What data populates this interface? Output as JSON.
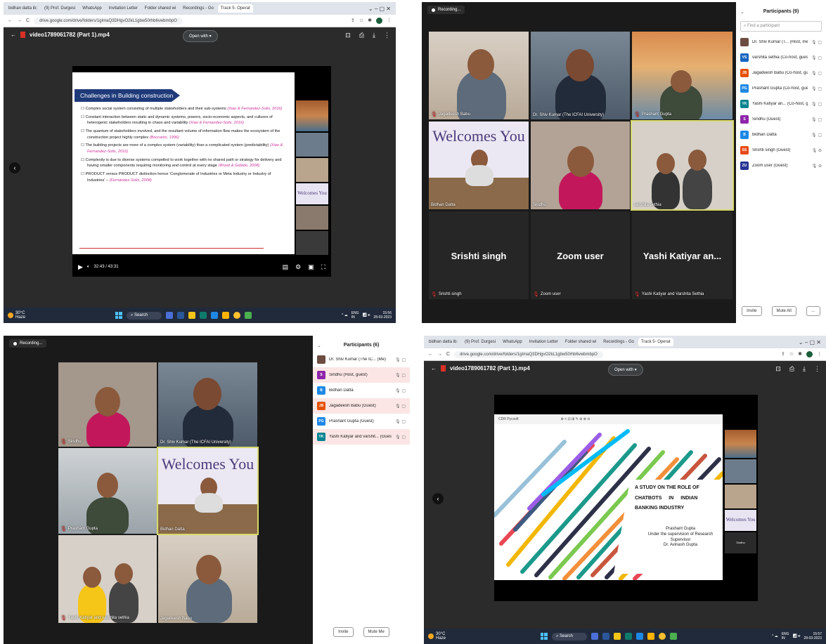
{
  "browser": {
    "tabs": [
      "bidhan datta ib:",
      "(9) Prof. Durgesi",
      "WhatsApp",
      "Invitation Letter",
      "Folder shared wi",
      "Recordings - Go",
      "Track 5- Operat"
    ],
    "url": "drive.google.com/drive/folders/1gImaQ3DHgvO2kL1gbw50rhb6vwbmbpO"
  },
  "player": {
    "file_name": "video1789061782 (Part 1).mp4",
    "open_with": "Open with",
    "time": "32:43 / 43:31"
  },
  "slide1": {
    "title": "Challenges in Building construction",
    "bullets": [
      {
        "text": "Complex social system consisting of multiple stakeholders and their sub-systems ",
        "cite": "(Xiao & Fernandez-Solis, 2016)"
      },
      {
        "text": "Constant interaction between static and dynamic systems, powers, socio-economic aspects, and cultures of heterogenic stakeholders resulting in chaos and variability ",
        "cite": "(Xiao & Fernandez-Solis, 2016)"
      },
      {
        "text": "The quantum of stakeholders involved, and the resultant volume of information flow makes the ecosystem of the construction project highly complex ",
        "cite": "(Boccarini, 1996)"
      },
      {
        "text": "The building projects are more of a complex system (variability) than a complicated system (predictability) ",
        "cite": "(Xiao & Fernandez-Solis, 2016)"
      },
      {
        "text": "Complexity is due to diverse systems compelled to work together with no shared path or strategy for delivery and having smaller components requiring monitoring and control at every stage ",
        "cite": "(Wood & Gidado, 2008)"
      },
      {
        "text": "PRODUCT versus PRODUCT distinction hence 'Conglomerate of Industries or Meta Industry or Industry of Industries' – ",
        "cite": "(Fernández-Solís, 2008)"
      }
    ]
  },
  "slide2": {
    "title_lines": [
      "A STUDY ON THE ROLE OF",
      "CHATBOTS IN INDIAN",
      "BANKING INDUSTRY"
    ],
    "author": "Prashant Gupta",
    "supervision": "Under the supervision of Research Supervisor",
    "supervisor": "Dr. Avinash Gupta",
    "toolbar_label": "CDR Pycsoft",
    "side_label": "Sindhu"
  },
  "welcome_text": "Welcomes You",
  "taskbar": {
    "temp": "30°C",
    "condition": "Haze",
    "search": "Search",
    "lang": "ENG",
    "region": "IN",
    "time1": "15:56",
    "date1": "28-03-2023",
    "time2": "15:57",
    "date2": "28-03-2023"
  },
  "meeting1": {
    "recording": "Recording...",
    "tiles": [
      "Jagadeesh Babu",
      "Dr. Shiv Kumar (The ICFAI University)",
      "Prashant Gupta",
      "Bidhan Datta",
      "Sindhu",
      "varshita sethia",
      "Srishti singh",
      "Zoom user",
      "Yashi Katiyar an..."
    ],
    "bottom_labels": [
      "Srishti singh",
      "Zoom user",
      "Yashi Katiyar and Varshita Sethia"
    ],
    "participants_title": "Participants (9)",
    "find": "Find a participant",
    "participants": [
      {
        "initials": "",
        "name": "Dr. Shiv Kumar (T... (Host, me)",
        "color": "#6d4c41"
      },
      {
        "initials": "VS",
        "name": "varshita sethia (Co-host, guest)",
        "color": "#1565c0"
      },
      {
        "initials": "JB",
        "name": "Jagadeesh Babu (Co-host, guest)",
        "color": "#e65100"
      },
      {
        "initials": "PG",
        "name": "Prashant Gupta (Co-host, guest)",
        "color": "#1e88e5"
      },
      {
        "initials": "YK",
        "name": "Yashi Katiyar an... (Co-host, guest)",
        "color": "#00838f"
      },
      {
        "initials": "S",
        "name": "Sindhu (Guest)",
        "color": "#8e24aa"
      },
      {
        "initials": "B",
        "name": "Bidhan Datta",
        "color": "#1e88e5"
      },
      {
        "initials": "SS",
        "name": "Srishti singh (Guest)",
        "color": "#e64a19"
      },
      {
        "initials": "ZU",
        "name": "Zoom user (Guest)",
        "color": "#283593"
      }
    ],
    "invite": "Invite",
    "mute_all": "Mute All"
  },
  "meeting2": {
    "recording": "Recording...",
    "tiles": [
      "Sindhu",
      "Dr. Shiv Kumar (The ICFAI University)",
      "Prashant Gupta",
      "Bidhan Datta",
      "Yashi Katiyar and varshita sethia",
      "Jagadeesh Babu"
    ],
    "participants_title": "Participants (6)",
    "participants": [
      {
        "initials": "",
        "name": "Dr. Shiv Kumar (The IC... (Me)",
        "color": "#6d4c41",
        "hl": false
      },
      {
        "initials": "S",
        "name": "Sindhu (Host, guest)",
        "color": "#8e24aa",
        "hl": true
      },
      {
        "initials": "B",
        "name": "Bidhan Datta",
        "color": "#1e88e5",
        "hl": false
      },
      {
        "initials": "JB",
        "name": "Jagadeesh Babu (Guest)",
        "color": "#e65100",
        "hl": true
      },
      {
        "initials": "PG",
        "name": "Prashant Gupta (Guest)",
        "color": "#1e88e5",
        "hl": false
      },
      {
        "initials": "YK",
        "name": "Yashi Katiyar and varshit... (Guest)",
        "color": "#00838f",
        "hl": true
      }
    ],
    "invite": "Invite",
    "mute_me": "Mute Me"
  },
  "colors": {
    "slide_title_bar": "#1f3a7a",
    "cite": "#cc3399",
    "zoom_mic_muted": "#e53935"
  }
}
